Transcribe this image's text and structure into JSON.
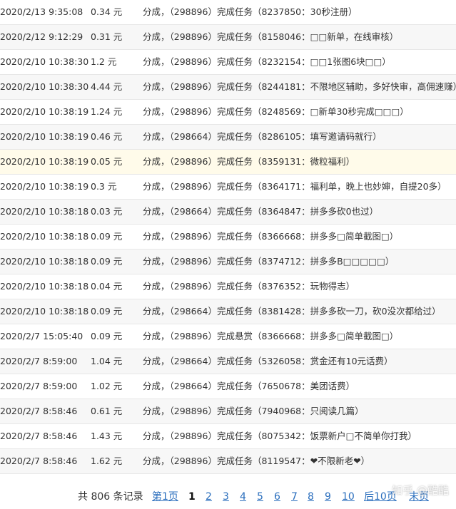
{
  "records": [
    {
      "time": "2020/2/13 9:35:08",
      "amount": "0.34 元",
      "desc": "分成，（298896）完成任务（8237850：30秒注册）"
    },
    {
      "time": "2020/2/12 9:12:29",
      "amount": "0.31 元",
      "desc": "分成，（298896）完成任务（8158046：□□新单，在线审核）"
    },
    {
      "time": "2020/2/10 10:38:30",
      "amount": "1.2 元",
      "desc": "分成，（298896）完成任务（8232154：□□1张图6块□□）"
    },
    {
      "time": "2020/2/10 10:38:30",
      "amount": "4.44 元",
      "desc": "分成，（298896）完成任务（8244181：不限地区辅助，多好快审，高佣速赚）"
    },
    {
      "time": "2020/2/10 10:38:19",
      "amount": "1.24 元",
      "desc": "分成，（298896）完成任务（8248569：□新单30秒完成□□□）"
    },
    {
      "time": "2020/2/10 10:38:19",
      "amount": "0.46 元",
      "desc": "分成，（298664）完成任务（8286105：填写邀请码就行）"
    },
    {
      "time": "2020/2/10 10:38:19",
      "amount": "0.05 元",
      "desc": "分成，（298896）完成任务（8359131：微粒福利）"
    },
    {
      "time": "2020/2/10 10:38:19",
      "amount": "0.3 元",
      "desc": "分成，（298896）完成任务（8364171：福利单，晚上也妙婶，自提20多）"
    },
    {
      "time": "2020/2/10 10:38:18",
      "amount": "0.03 元",
      "desc": "分成，（298664）完成任务（8364847：拼多多砍0也过）"
    },
    {
      "time": "2020/2/10 10:38:18",
      "amount": "0.09 元",
      "desc": "分成，（298896）完成任务（8366668：拼多多□简单截图□）"
    },
    {
      "time": "2020/2/10 10:38:18",
      "amount": "0.09 元",
      "desc": "分成，（298896）完成任务（8374712：拼多多B□□□□□）"
    },
    {
      "time": "2020/2/10 10:38:18",
      "amount": "0.04 元",
      "desc": "分成，（298896）完成任务（8376352：玩物得志）"
    },
    {
      "time": "2020/2/10 10:38:18",
      "amount": "0.09 元",
      "desc": "分成，（298664）完成任务（8381428：拼多多砍一刀，砍0没次都给过）"
    },
    {
      "time": "2020/2/7 15:05:40",
      "amount": "0.09 元",
      "desc": "分成，（298896）完成悬赏（8366668：拼多多□简单截图□）"
    },
    {
      "time": "2020/2/7 8:59:00",
      "amount": "1.04 元",
      "desc": "分成，（298664）完成任务（5326058：赏金还有10元话费）"
    },
    {
      "time": "2020/2/7 8:59:00",
      "amount": "1.02 元",
      "desc": "分成，（298664）完成任务（7650678：美团话费）"
    },
    {
      "time": "2020/2/7 8:58:46",
      "amount": "0.61 元",
      "desc": "分成，（298896）完成任务（7940968：只阅读几篇）"
    },
    {
      "time": "2020/2/7 8:58:46",
      "amount": "1.43 元",
      "desc": "分成，（298896）完成任务（8075342：饭票新户□不简单你打我）"
    },
    {
      "time": "2020/2/7 8:58:46",
      "amount": "1.62 元",
      "desc": "分成，（298896）完成任务（8119547：❤不限新老❤）"
    }
  ],
  "pagination": {
    "total_text": "共 806 条记录",
    "first": "第1页",
    "current": "1",
    "pages": [
      "2",
      "3",
      "4",
      "5",
      "6",
      "7",
      "8",
      "9",
      "10"
    ],
    "next10": "后10页",
    "last": "末页"
  },
  "watermark": "知乎 @酷酷"
}
